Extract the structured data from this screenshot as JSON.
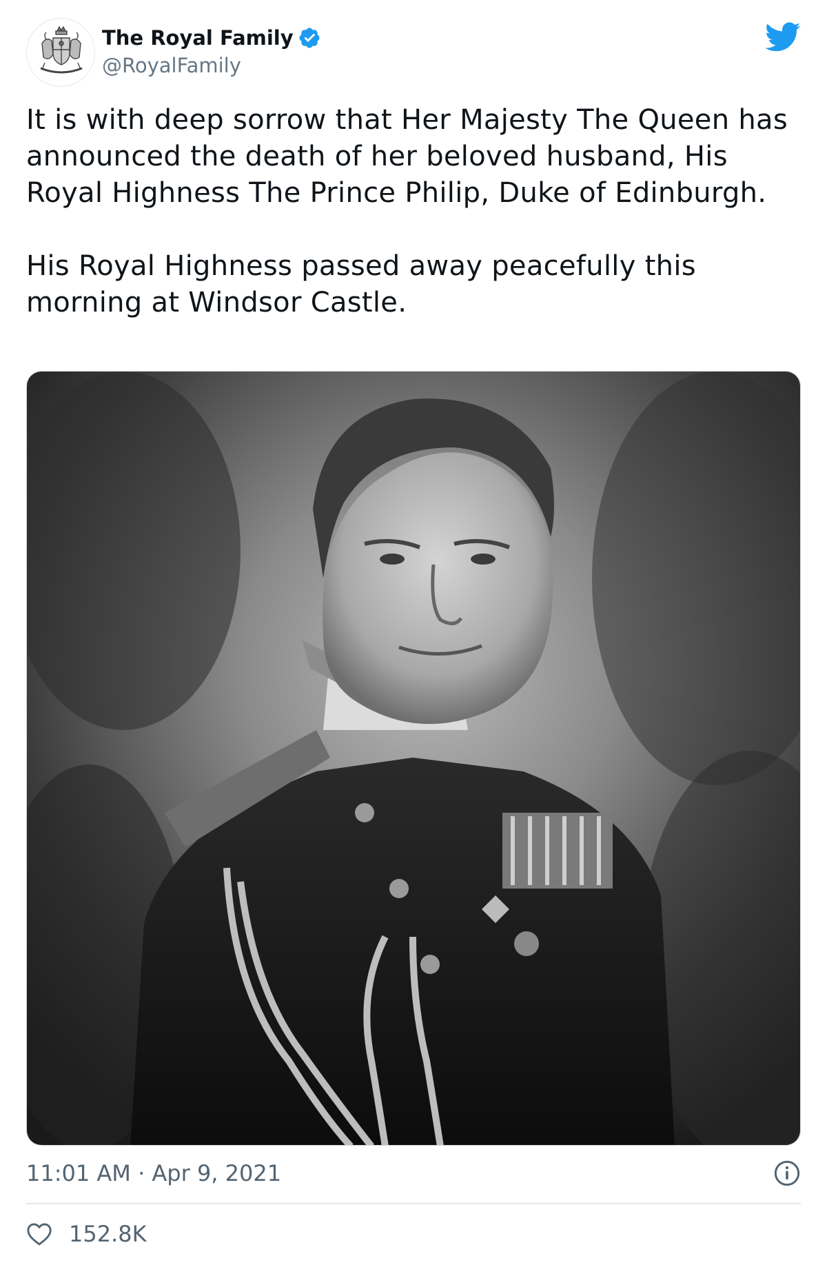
{
  "tweet": {
    "author": {
      "display_name": "The Royal Family",
      "handle": "@RoyalFamily",
      "verified": true,
      "avatar_icon": "royal-coat-of-arms-icon"
    },
    "platform_icon": "twitter-bird-icon",
    "paragraphs": [
      "It is with deep sorrow that Her Majesty The Queen has announced the death of her beloved husband, His Royal Highness The Prince Philip, Duke of Edinburgh.",
      "His Royal Highness passed away peacefully this morning at Windsor Castle."
    ],
    "timestamp": "11:01 AM · Apr 9, 2021",
    "likes": "152.8K",
    "colors": {
      "brand_blue": "#1d9bf0",
      "text_primary": "#0f1419",
      "text_secondary": "#536471",
      "divider": "#e1e8ed"
    }
  }
}
